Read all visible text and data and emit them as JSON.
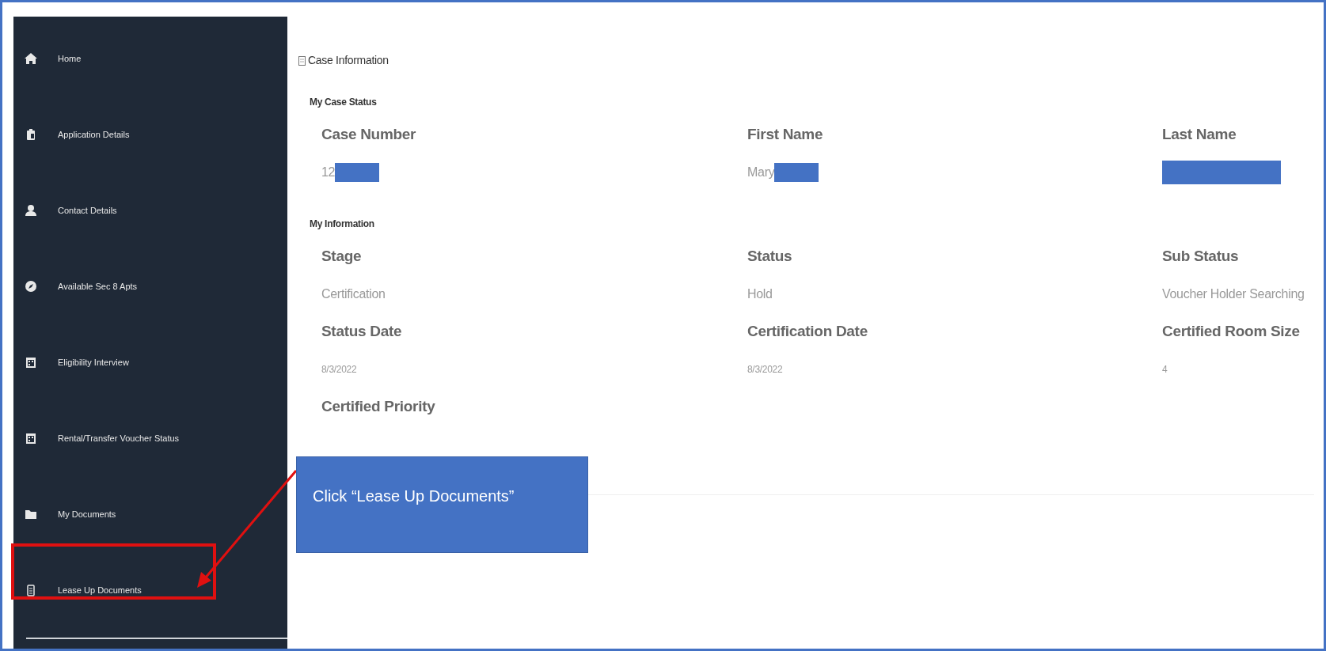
{
  "sidebar": {
    "items": [
      {
        "label": "Home",
        "highlighted": false
      },
      {
        "label": "Application Details",
        "highlighted": false
      },
      {
        "label": "Contact Details",
        "highlighted": false
      },
      {
        "label": "Available Sec 8 Apts",
        "highlighted": false
      },
      {
        "label": "Eligibility Interview",
        "highlighted": false
      },
      {
        "label": "Rental/Transfer Voucher Status",
        "highlighted": false
      },
      {
        "label": "My Documents",
        "highlighted": false
      },
      {
        "label": "Lease Up Documents",
        "highlighted": true
      }
    ]
  },
  "panel": {
    "title": "Case Information",
    "sections": [
      {
        "heading": "My Case Status",
        "fields": [
          {
            "label": "Case Number",
            "value": "12",
            "redacted": true
          },
          {
            "label": "First Name",
            "value": "Mary",
            "redacted": true
          },
          {
            "label": "Last Name",
            "redacted": true
          }
        ]
      },
      {
        "heading": "My Information",
        "fields": [
          {
            "label": "Stage",
            "value": "Certification",
            "redacted": false
          },
          {
            "label": "Status",
            "value": "Hold",
            "redacted": false
          },
          {
            "label": "Sub Status",
            "value": "Voucher Holder Searching",
            "redacted": false
          },
          {
            "label": "Status Date",
            "value": "8/3/2022",
            "kind": "small",
            "redacted": false
          },
          {
            "label": "Certification Date",
            "value": "8/3/2022",
            "kind": "small",
            "redacted": false
          },
          {
            "label": "Certified Room Size",
            "value": "4",
            "kind": "small",
            "redacted": false
          },
          {
            "label": "Certified Priority",
            "redacted": false
          }
        ]
      }
    ]
  },
  "callout": {
    "text": "Click “Lease Up Documents”"
  }
}
